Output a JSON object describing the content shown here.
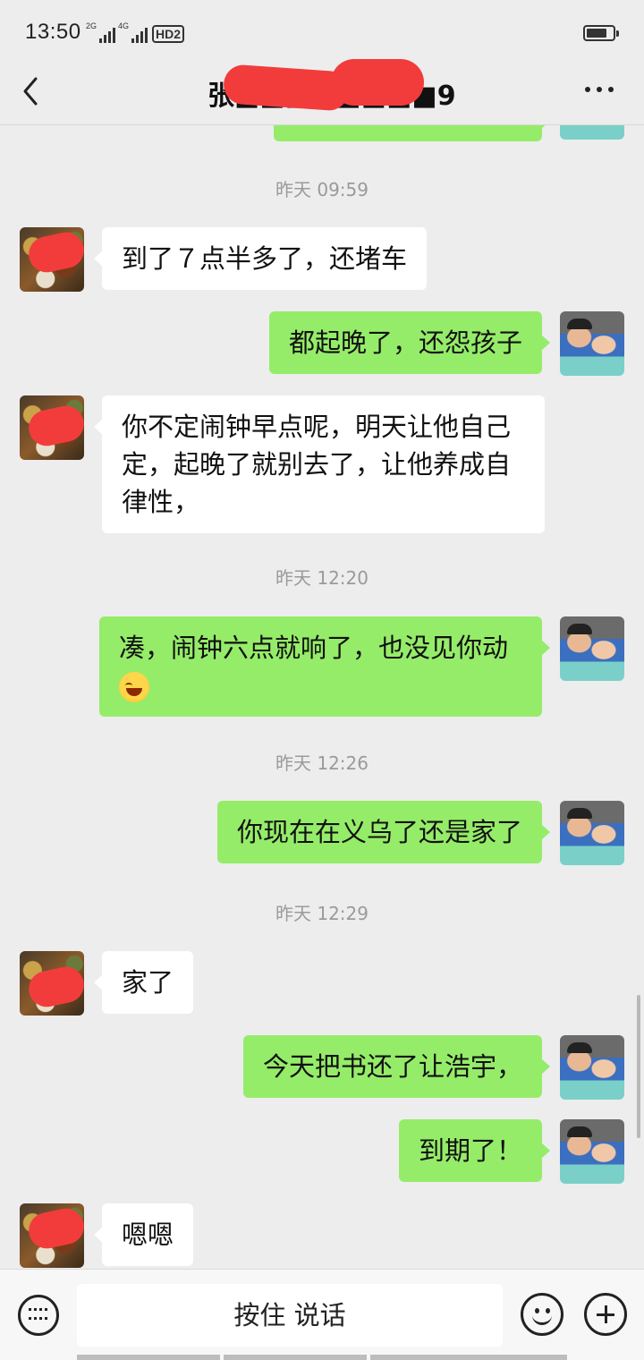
{
  "status_bar": {
    "time": "13:50",
    "net1": "2G",
    "net2": "4G",
    "hd": "HD2",
    "battery_level": 0.8
  },
  "header": {
    "back_icon": "chevron-left-icon",
    "title": "张■■■■■■■■9",
    "more_icon": "more-dots-icon"
  },
  "messages": [
    {
      "from": "self",
      "text": ""
    },
    {
      "type": "time",
      "text": "昨天 09:59"
    },
    {
      "from": "other",
      "text": "到了７点半多了，还堵车"
    },
    {
      "from": "self",
      "text": "都起晚了，还怨孩子"
    },
    {
      "from": "other",
      "text": "你不定闹钟早点呢，明天让他自己定，起晚了就别去了，让他养成自律性，"
    },
    {
      "type": "time",
      "text": "昨天 12:20"
    },
    {
      "from": "self",
      "text": "凑，闹钟六点就响了，也没见你动",
      "emoji": "laugh-cry-emoji"
    },
    {
      "type": "time",
      "text": "昨天 12:26"
    },
    {
      "from": "self",
      "text": "你现在在义乌了还是家了"
    },
    {
      "type": "time",
      "text": "昨天 12:29"
    },
    {
      "from": "other",
      "text": "家了"
    },
    {
      "from": "self",
      "text": "今天把书还了让浩宇，"
    },
    {
      "from": "self",
      "text": "到期了！"
    },
    {
      "from": "other",
      "text": "嗯嗯"
    }
  ],
  "input_bar": {
    "keyboard_icon": "keyboard-icon",
    "voice_label": "按住 说话",
    "emoji_icon": "emoji-icon",
    "plus_icon": "plus-icon"
  },
  "colors": {
    "background": "#ededed",
    "bubble_self": "#95ec69",
    "bubble_other": "#ffffff",
    "redaction": "#f23c3c"
  }
}
